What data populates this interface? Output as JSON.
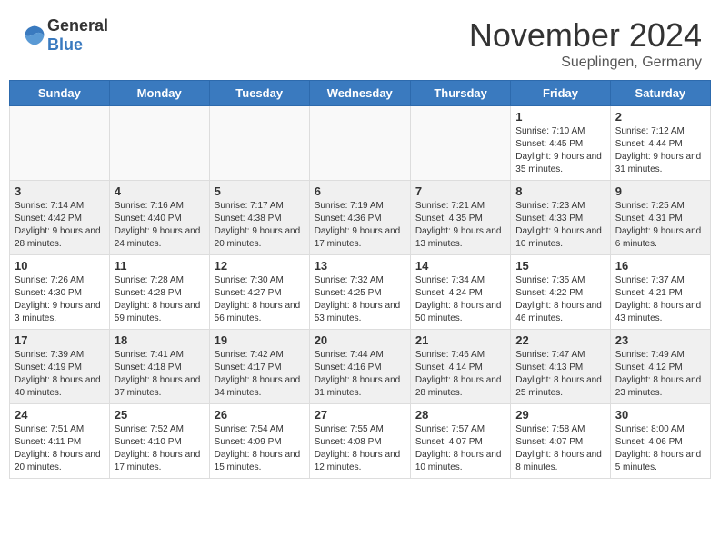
{
  "header": {
    "logo": {
      "general": "General",
      "blue": "Blue"
    },
    "title": "November 2024",
    "location": "Sueplingen, Germany"
  },
  "days_of_week": [
    "Sunday",
    "Monday",
    "Tuesday",
    "Wednesday",
    "Thursday",
    "Friday",
    "Saturday"
  ],
  "weeks": [
    [
      {
        "day": "",
        "info": ""
      },
      {
        "day": "",
        "info": ""
      },
      {
        "day": "",
        "info": ""
      },
      {
        "day": "",
        "info": ""
      },
      {
        "day": "",
        "info": ""
      },
      {
        "day": "1",
        "info": "Sunrise: 7:10 AM\nSunset: 4:45 PM\nDaylight: 9 hours and 35 minutes."
      },
      {
        "day": "2",
        "info": "Sunrise: 7:12 AM\nSunset: 4:44 PM\nDaylight: 9 hours and 31 minutes."
      }
    ],
    [
      {
        "day": "3",
        "info": "Sunrise: 7:14 AM\nSunset: 4:42 PM\nDaylight: 9 hours and 28 minutes."
      },
      {
        "day": "4",
        "info": "Sunrise: 7:16 AM\nSunset: 4:40 PM\nDaylight: 9 hours and 24 minutes."
      },
      {
        "day": "5",
        "info": "Sunrise: 7:17 AM\nSunset: 4:38 PM\nDaylight: 9 hours and 20 minutes."
      },
      {
        "day": "6",
        "info": "Sunrise: 7:19 AM\nSunset: 4:36 PM\nDaylight: 9 hours and 17 minutes."
      },
      {
        "day": "7",
        "info": "Sunrise: 7:21 AM\nSunset: 4:35 PM\nDaylight: 9 hours and 13 minutes."
      },
      {
        "day": "8",
        "info": "Sunrise: 7:23 AM\nSunset: 4:33 PM\nDaylight: 9 hours and 10 minutes."
      },
      {
        "day": "9",
        "info": "Sunrise: 7:25 AM\nSunset: 4:31 PM\nDaylight: 9 hours and 6 minutes."
      }
    ],
    [
      {
        "day": "10",
        "info": "Sunrise: 7:26 AM\nSunset: 4:30 PM\nDaylight: 9 hours and 3 minutes."
      },
      {
        "day": "11",
        "info": "Sunrise: 7:28 AM\nSunset: 4:28 PM\nDaylight: 8 hours and 59 minutes."
      },
      {
        "day": "12",
        "info": "Sunrise: 7:30 AM\nSunset: 4:27 PM\nDaylight: 8 hours and 56 minutes."
      },
      {
        "day": "13",
        "info": "Sunrise: 7:32 AM\nSunset: 4:25 PM\nDaylight: 8 hours and 53 minutes."
      },
      {
        "day": "14",
        "info": "Sunrise: 7:34 AM\nSunset: 4:24 PM\nDaylight: 8 hours and 50 minutes."
      },
      {
        "day": "15",
        "info": "Sunrise: 7:35 AM\nSunset: 4:22 PM\nDaylight: 8 hours and 46 minutes."
      },
      {
        "day": "16",
        "info": "Sunrise: 7:37 AM\nSunset: 4:21 PM\nDaylight: 8 hours and 43 minutes."
      }
    ],
    [
      {
        "day": "17",
        "info": "Sunrise: 7:39 AM\nSunset: 4:19 PM\nDaylight: 8 hours and 40 minutes."
      },
      {
        "day": "18",
        "info": "Sunrise: 7:41 AM\nSunset: 4:18 PM\nDaylight: 8 hours and 37 minutes."
      },
      {
        "day": "19",
        "info": "Sunrise: 7:42 AM\nSunset: 4:17 PM\nDaylight: 8 hours and 34 minutes."
      },
      {
        "day": "20",
        "info": "Sunrise: 7:44 AM\nSunset: 4:16 PM\nDaylight: 8 hours and 31 minutes."
      },
      {
        "day": "21",
        "info": "Sunrise: 7:46 AM\nSunset: 4:14 PM\nDaylight: 8 hours and 28 minutes."
      },
      {
        "day": "22",
        "info": "Sunrise: 7:47 AM\nSunset: 4:13 PM\nDaylight: 8 hours and 25 minutes."
      },
      {
        "day": "23",
        "info": "Sunrise: 7:49 AM\nSunset: 4:12 PM\nDaylight: 8 hours and 23 minutes."
      }
    ],
    [
      {
        "day": "24",
        "info": "Sunrise: 7:51 AM\nSunset: 4:11 PM\nDaylight: 8 hours and 20 minutes."
      },
      {
        "day": "25",
        "info": "Sunrise: 7:52 AM\nSunset: 4:10 PM\nDaylight: 8 hours and 17 minutes."
      },
      {
        "day": "26",
        "info": "Sunrise: 7:54 AM\nSunset: 4:09 PM\nDaylight: 8 hours and 15 minutes."
      },
      {
        "day": "27",
        "info": "Sunrise: 7:55 AM\nSunset: 4:08 PM\nDaylight: 8 hours and 12 minutes."
      },
      {
        "day": "28",
        "info": "Sunrise: 7:57 AM\nSunset: 4:07 PM\nDaylight: 8 hours and 10 minutes."
      },
      {
        "day": "29",
        "info": "Sunrise: 7:58 AM\nSunset: 4:07 PM\nDaylight: 8 hours and 8 minutes."
      },
      {
        "day": "30",
        "info": "Sunrise: 8:00 AM\nSunset: 4:06 PM\nDaylight: 8 hours and 5 minutes."
      }
    ]
  ]
}
